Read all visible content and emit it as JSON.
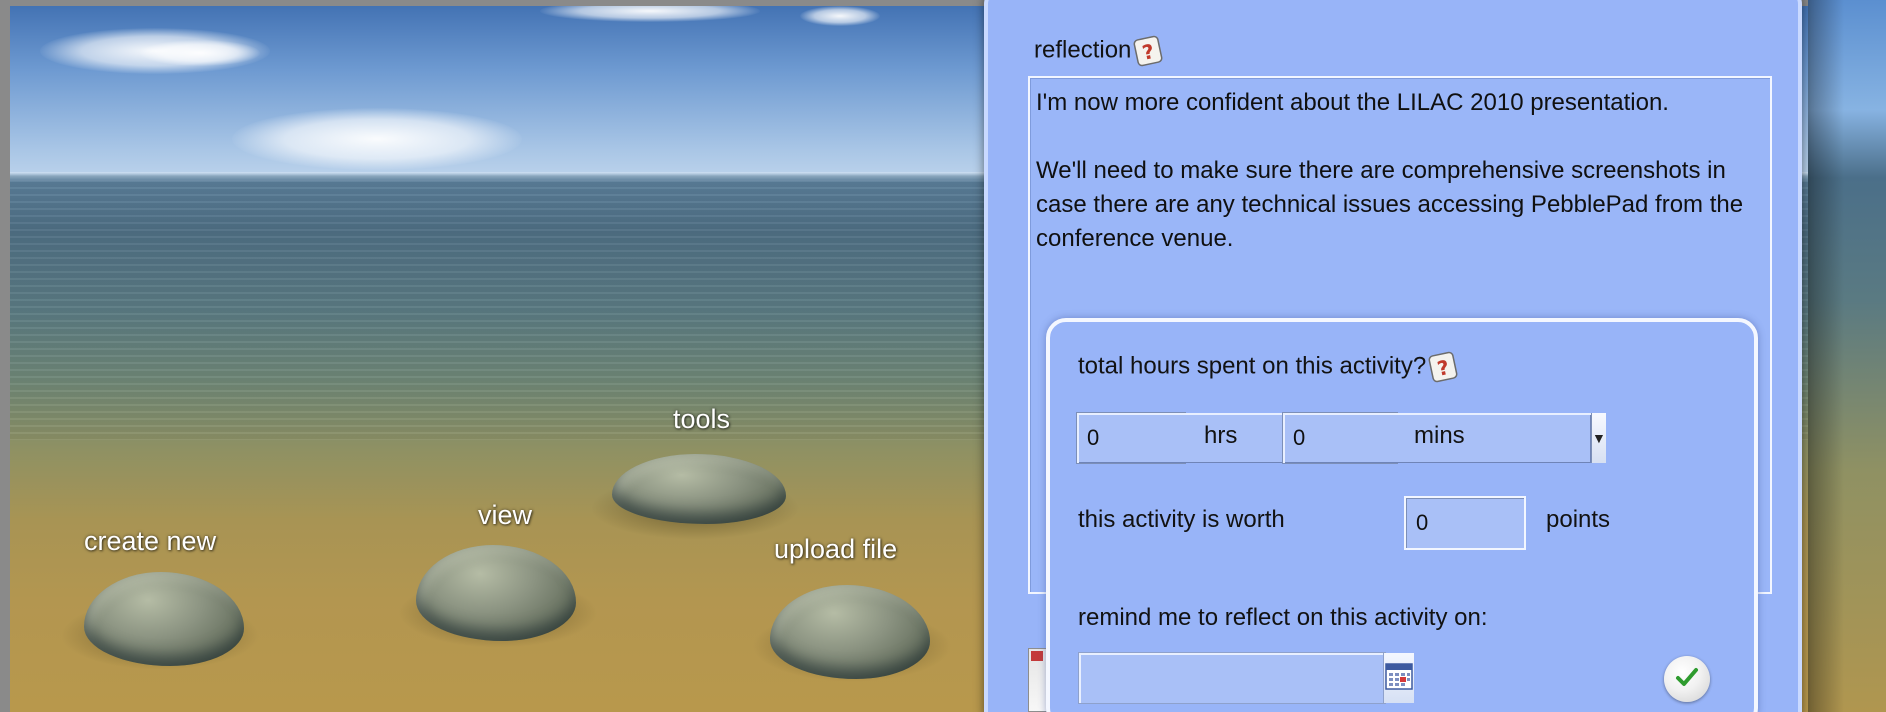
{
  "scene": {
    "stones": [
      {
        "label": "create new"
      },
      {
        "label": "view"
      },
      {
        "label": "tools"
      },
      {
        "label": "upload file"
      }
    ]
  },
  "reflection": {
    "label": "reflection",
    "help_icon": "help-icon",
    "paragraphs": [
      "I'm now more confident about the LILAC 2010 presentation.",
      "We'll need to make sure there are comprehensive screenshots in case there are any technical issues accessing PebblePad from the conference venue."
    ]
  },
  "popup": {
    "hours_question": "total hours spent on this activity?",
    "hours": {
      "value": "0",
      "unit": "hrs"
    },
    "mins": {
      "value": "0",
      "unit": "mins"
    },
    "worth_label": "this activity is worth",
    "points_value": "0",
    "points_unit": "points",
    "remind_label": "remind me to reflect on this activity on:",
    "date_value": "",
    "calendar_icon": "calendar-icon",
    "confirm_icon": "checkmark-icon"
  },
  "colors": {
    "panel_bg": "#98b4f8",
    "panel_border": "#c9d9ff",
    "confirm_green": "#2e9b2e",
    "help_red": "#c0392b"
  }
}
